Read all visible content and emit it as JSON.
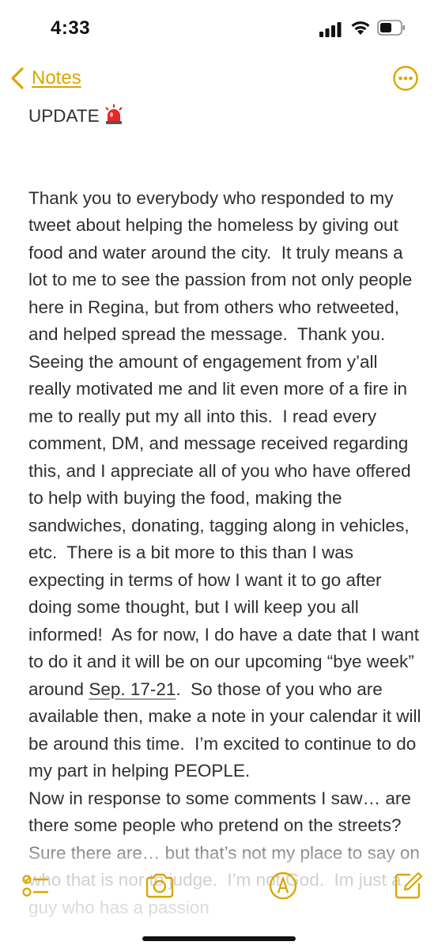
{
  "status_bar": {
    "time": "4:33"
  },
  "nav": {
    "back_label": "Notes",
    "more_icon": "ellipsis-circle-icon"
  },
  "note": {
    "title": "UPDATE",
    "title_emoji": "siren-icon",
    "body_part1": "Thank you to everybody who responded to my tweet about helping the homeless by giving out food and water around the city.  It truly means a lot to me to see the passion from not only people here in Regina, but from others who retweeted, and helped spread the message.  Thank you.\nSeeing the amount of engagement from y’all really motivated me and lit even more of a fire in me to really put my all into this.  I read every comment, DM, and message received regarding this, and I appreciate all of you who have offered to help with buying the food, making the sandwiches, donating, tagging along in vehicles, etc.  There is a bit more to this than I was expecting in terms of how I want it to go after doing some thought, but I will keep you all informed!  As for now, I do have a date that I want to do it and it will be on our upcoming “bye week” around ",
    "date": "Sep. 17-21",
    "body_part2": ".  So those of you who are available then, make a note in your calendar it will be around this time.  I’m excited to continue to do my part in helping PEOPLE.\nNow in response to some comments I saw… are there some people who pretend on the streets?  Sure there are… but that’s not my place to say on who that is nor to judge.  I’m not God.  Im just a guy who has a passion"
  },
  "toolbar": {
    "checklist_icon": "checklist-icon",
    "camera_icon": "camera-icon",
    "markup_icon": "markup-pen-icon",
    "compose_icon": "compose-icon"
  },
  "colors": {
    "accent": "#d9a700",
    "text": "#2f2f2f",
    "background": "#ffffff"
  }
}
